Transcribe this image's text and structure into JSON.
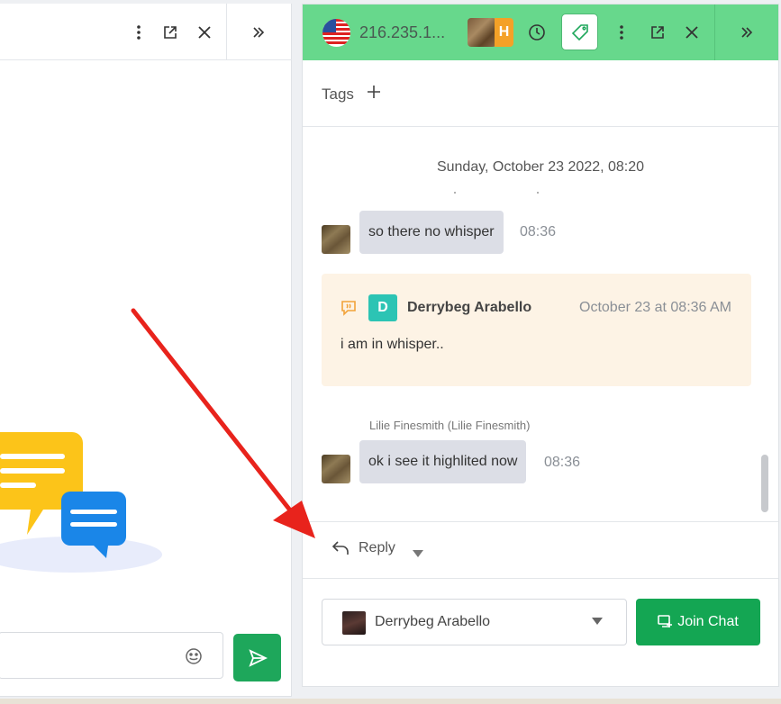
{
  "right_panel": {
    "header": {
      "ip": "216.235.1...",
      "badge_letter": "H",
      "colors": {
        "header_bg": "#67d88c",
        "badge": "#f4a127"
      }
    },
    "tags": {
      "label": "Tags"
    },
    "date_separator": "Sunday, October 23 2022, 08:20",
    "messages": [
      {
        "text": "so there no whisper",
        "time": "08:36"
      },
      {
        "sender": "Lilie Finesmith (Lilie Finesmith)",
        "text": "ok i see it highlited now",
        "time": "08:36"
      }
    ],
    "whisper": {
      "initial": "D",
      "name": "Derrybeg Arabello",
      "date": "October 23 at 08:36 AM",
      "text": "i am in whisper.."
    },
    "reply": {
      "label": "Reply"
    },
    "footer": {
      "agent_name": "Derrybeg Arabello",
      "join_label": "Join Chat",
      "colors": {
        "join_bg": "#14a653"
      }
    }
  }
}
